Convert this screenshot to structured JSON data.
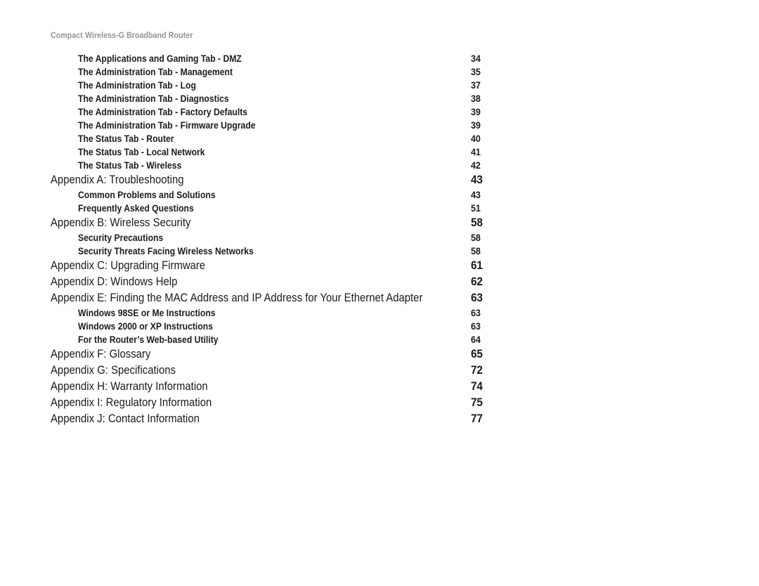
{
  "header": {
    "running_title": "Compact Wireless-G Broadband Router"
  },
  "toc": {
    "entries": [
      {
        "level": "sub",
        "title": "The Applications and Gaming Tab - DMZ",
        "page": "34"
      },
      {
        "level": "sub",
        "title": "The Administration Tab - Management",
        "page": "35"
      },
      {
        "level": "sub",
        "title": "The Administration Tab - Log",
        "page": "37"
      },
      {
        "level": "sub",
        "title": "The Administration Tab - Diagnostics",
        "page": "38"
      },
      {
        "level": "sub",
        "title": "The Administration Tab - Factory Defaults",
        "page": "39"
      },
      {
        "level": "sub",
        "title": "The Administration Tab - Firmware Upgrade",
        "page": "39"
      },
      {
        "level": "sub",
        "title": "The Status Tab - Router",
        "page": "40"
      },
      {
        "level": "sub",
        "title": "The Status Tab - Local Network",
        "page": "41"
      },
      {
        "level": "sub",
        "title": "The Status Tab - Wireless",
        "page": "42"
      },
      {
        "level": "appendix",
        "title": "Appendix A: Troubleshooting",
        "page": "43"
      },
      {
        "level": "sub",
        "title": "Common Problems and Solutions",
        "page": "43"
      },
      {
        "level": "sub",
        "title": "Frequently Asked Questions",
        "page": "51"
      },
      {
        "level": "appendix",
        "title": "Appendix B: Wireless Security",
        "page": "58"
      },
      {
        "level": "sub",
        "title": "Security Precautions",
        "page": "58"
      },
      {
        "level": "sub",
        "title": "Security Threats Facing Wireless Networks",
        "page": "58"
      },
      {
        "level": "appendix",
        "title": "Appendix C: Upgrading Firmware",
        "page": "61"
      },
      {
        "level": "appendix",
        "title": "Appendix D: Windows Help",
        "page": "62"
      },
      {
        "level": "appendix",
        "title": "Appendix E: Finding the MAC Address and IP Address for Your Ethernet Adapter",
        "page": "63"
      },
      {
        "level": "sub",
        "title": "Windows 98SE or Me Instructions",
        "page": "63"
      },
      {
        "level": "sub",
        "title": "Windows 2000 or XP Instructions",
        "page": "63"
      },
      {
        "level": "sub",
        "title": "For the Router’s Web-based Utility",
        "page": "64"
      },
      {
        "level": "appendix",
        "title": "Appendix F: Glossary",
        "page": "65"
      },
      {
        "level": "appendix",
        "title": "Appendix G: Specifications",
        "page": "72"
      },
      {
        "level": "appendix",
        "title": "Appendix H: Warranty Information",
        "page": "74"
      },
      {
        "level": "appendix",
        "title": "Appendix I: Regulatory Information",
        "page": "75"
      },
      {
        "level": "appendix",
        "title": "Appendix J: Contact Information",
        "page": "77"
      }
    ]
  }
}
